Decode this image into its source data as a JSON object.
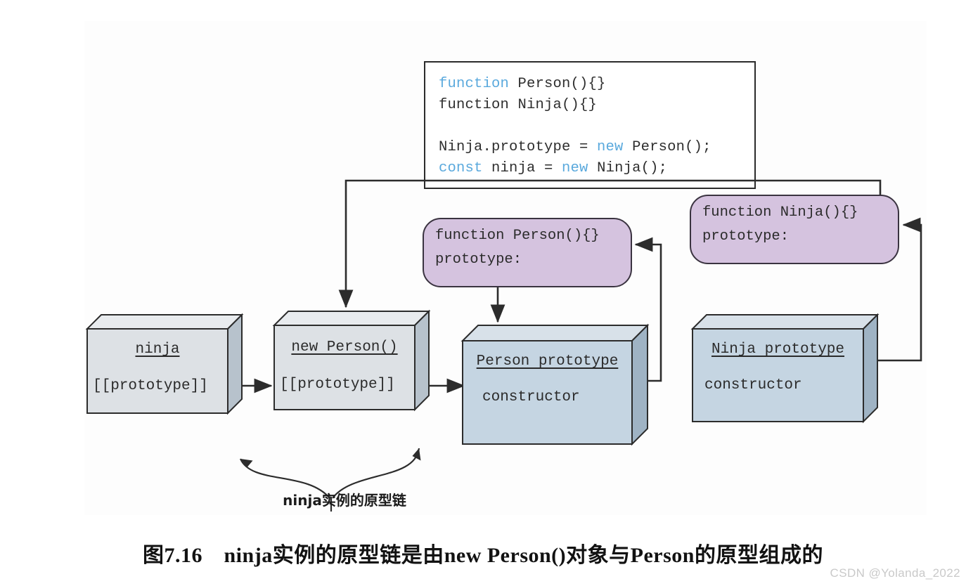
{
  "figure": {
    "caption": "图7.16　ninja实例的原型链是由new Person()对象与Person的原型组成的",
    "watermark": "CSDN @Yolanda_2022",
    "chain_label": "ninja实例的原型链"
  },
  "code_listing": {
    "lines": [
      [
        {
          "t": "function ",
          "c": "keyword"
        },
        {
          "t": "Person(){}",
          "c": "plain"
        }
      ],
      [
        {
          "t": "function Ninja(){}",
          "c": "plain"
        }
      ],
      [
        {
          "t": "",
          "c": "plain"
        }
      ],
      [
        {
          "t": "Ninja.prototype = ",
          "c": "plain"
        },
        {
          "t": "new",
          "c": "keyword"
        },
        {
          "t": " Person();",
          "c": "plain"
        }
      ],
      [
        {
          "t": "const",
          "c": "keyword"
        },
        {
          "t": " ninja = ",
          "c": "plain"
        },
        {
          "t": "new",
          "c": "keyword"
        },
        {
          "t": " Ninja();",
          "c": "plain"
        }
      ]
    ],
    "plain_text": "function Person(){}\nfunction Ninja(){}\n\nNinja.prototype = new Person();\nconst ninja = new Ninja();"
  },
  "function_boxes": [
    {
      "id": "person-function",
      "line1": "function Person(){}",
      "line2": "prototype:"
    },
    {
      "id": "ninja-function",
      "line1": "function Ninja(){}",
      "line2": "prototype:"
    }
  ],
  "object_boxes": [
    {
      "id": "ninja-instance",
      "title": "ninja",
      "field": "[[prototype]]"
    },
    {
      "id": "new-person",
      "title": "new Person()",
      "field": "[[prototype]]"
    },
    {
      "id": "person-prototype",
      "title": "Person prototype",
      "field": "constructor"
    },
    {
      "id": "ninja-prototype",
      "title": "Ninja prototype",
      "field": "constructor"
    }
  ],
  "colors": {
    "purple_fill": "#d5c3df",
    "gray_fill": "#dde1e5",
    "blue_fill": "#c5d5e2",
    "stroke": "#2c2c2c",
    "keyword": "#5aa9dd",
    "panel_bg": "#fdfdfd"
  }
}
